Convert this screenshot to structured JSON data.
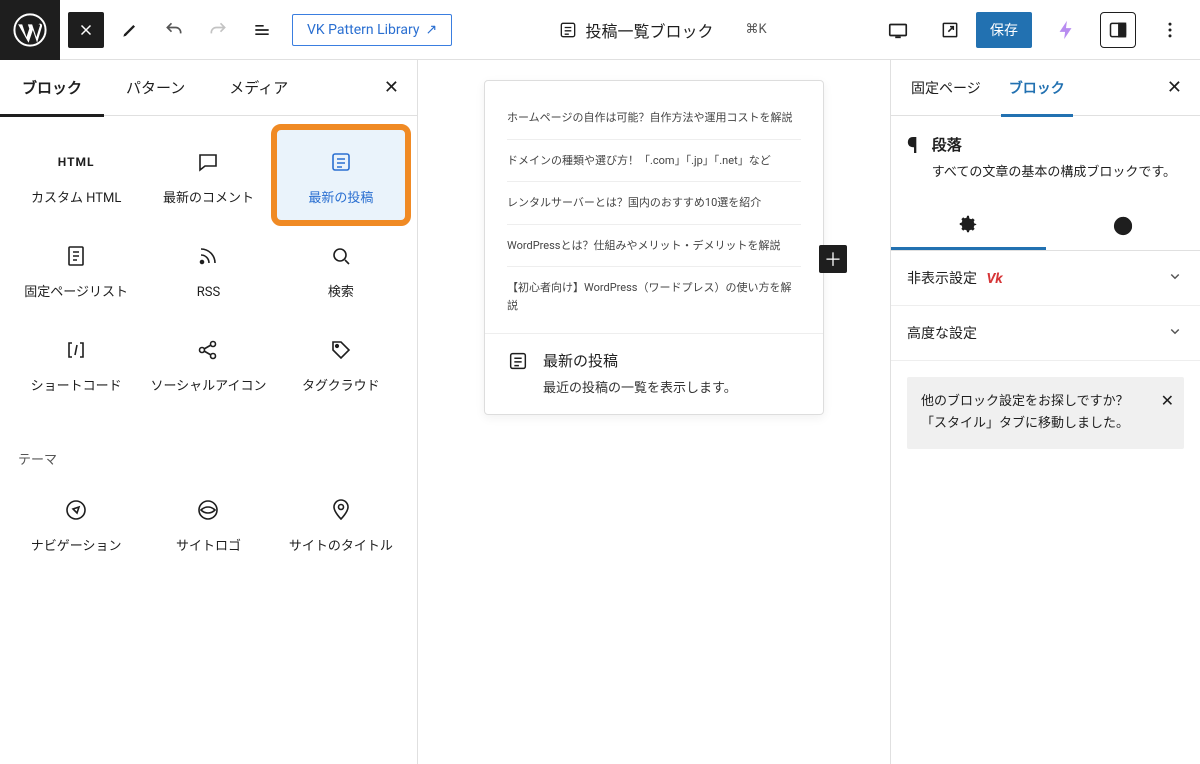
{
  "topbar": {
    "vk_link": "VK Pattern Library",
    "title": "投稿一覧ブロック",
    "shortcut": "⌘K",
    "save": "保存"
  },
  "left": {
    "tabs": {
      "blocks": "ブロック",
      "patterns": "パターン",
      "media": "メディア"
    },
    "items": {
      "custom_html": "カスタム HTML",
      "latest_comments": "最新のコメント",
      "latest_posts": "最新の投稿",
      "page_list": "固定ページリスト",
      "rss": "RSS",
      "search": "検索",
      "shortcode": "ショートコード",
      "social_icons": "ソーシャルアイコン",
      "tag_cloud": "タグクラウド",
      "navigation": "ナビゲーション",
      "site_logo": "サイトロゴ",
      "site_title": "サイトのタイトル"
    },
    "section_theme": "テーマ",
    "html_badge": "HTML"
  },
  "canvas": {
    "rows": [
      "ホームページの自作は可能？自作方法や運用コストを解説",
      "ドメインの種類や選び方！「.com」「.jp」「.net」など",
      "レンタルサーバーとは？国内のおすすめ10選を紹介",
      "WordPressとは？仕組みやメリット・デメリットを解説",
      "【初心者向け】WordPress（ワードプレス）の使い方を解説"
    ],
    "footer_title": "最新の投稿",
    "footer_text": "最近の投稿の一覧を表示します。"
  },
  "right": {
    "tab_page": "固定ページ",
    "tab_block": "ブロック",
    "block_title": "段落",
    "block_text": "すべての文章の基本の構成ブロックです。",
    "hide_settings": "非表示設定",
    "advanced": "高度な設定",
    "notice": "他のブロック設定をお探しですか？ 「スタイル」タブに移動しました。"
  }
}
